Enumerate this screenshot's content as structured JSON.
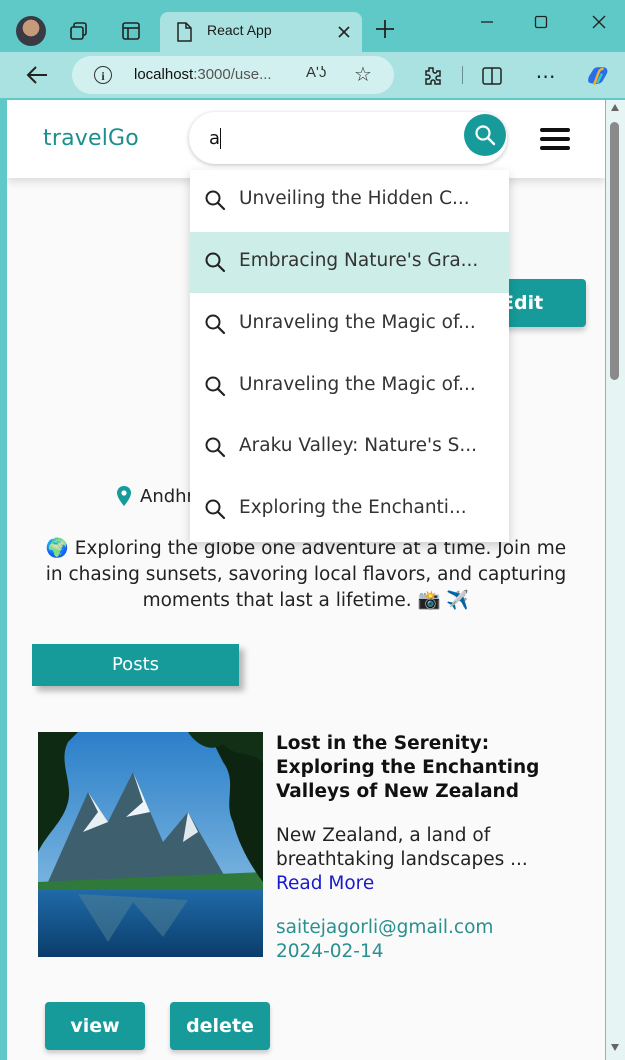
{
  "browser": {
    "tab_title": "React App",
    "url_host": "localhost",
    "url_rest": ":3000/use...",
    "read_aloud_label": "Aʹʖ"
  },
  "app": {
    "brand": "travelGo",
    "search": {
      "value": "a"
    },
    "suggestions": [
      "Unveiling the Hidden C...",
      "Embracing Nature's Gra...",
      "Unraveling the Magic of...",
      "Unraveling the Magic of...",
      "Araku Valley: Nature's S...",
      "Exploring the Enchanti..."
    ],
    "edit_label": "Edit",
    "location": "Andhra Pradesh",
    "bio": "🌍 Exploring the globe one adventure at a time. Join me in chasing sunsets, savoring local flavors, and capturing moments that last a lifetime. 📸 ✈️",
    "posts_tab": "Posts",
    "post": {
      "title": "Lost in the Serenity: Exploring the Enchanting Valleys of New Zealand",
      "excerpt": "New Zealand, a land of breathtaking landscapes ...",
      "read_more": "Read More",
      "email": "saitejagorli@gmail.com",
      "date": "2024-02-14",
      "view_label": "view",
      "delete_label": "delete"
    }
  },
  "colors": {
    "accent": "#169b9a",
    "chrome": "#5ec9c6",
    "highlight": "#cdeee8"
  }
}
